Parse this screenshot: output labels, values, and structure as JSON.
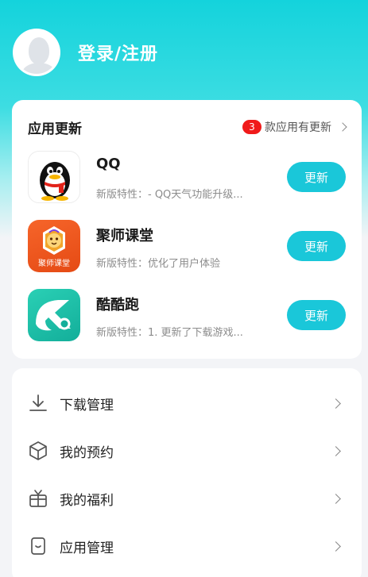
{
  "profile": {
    "login_label": "登录/注册"
  },
  "updates": {
    "title": "应用更新",
    "count": "3",
    "count_suffix": "款应用有更新",
    "apps": [
      {
        "name": "QQ",
        "desc": "新版特性：- QQ天气功能升级...",
        "button": "更新",
        "icon": "qq-penguin-icon"
      },
      {
        "name": "聚师课堂",
        "desc": "新版特性：优化了用户体验",
        "button": "更新",
        "icon": "jushi-lion-icon",
        "icon_caption": "聚师课堂"
      },
      {
        "name": "酷酷跑",
        "desc": "新版特性：1. 更新了下载游戏...",
        "button": "更新",
        "icon": "kukupao-k-icon"
      }
    ]
  },
  "menu": {
    "items": [
      {
        "label": "下载管理",
        "icon": "download-icon"
      },
      {
        "label": "我的预约",
        "icon": "box-icon"
      },
      {
        "label": "我的福利",
        "icon": "gift-icon"
      },
      {
        "label": "应用管理",
        "icon": "app-manage-icon"
      }
    ]
  },
  "colors": {
    "header_gradient_top": "#14d3dc",
    "button": "#1ac7d9",
    "badge": "#f01a1a",
    "qq_icon_bg": "#ffffff",
    "jushi_icon_bg": "#f0591f",
    "kukupao_icon_bg": "#1fbfa8"
  }
}
